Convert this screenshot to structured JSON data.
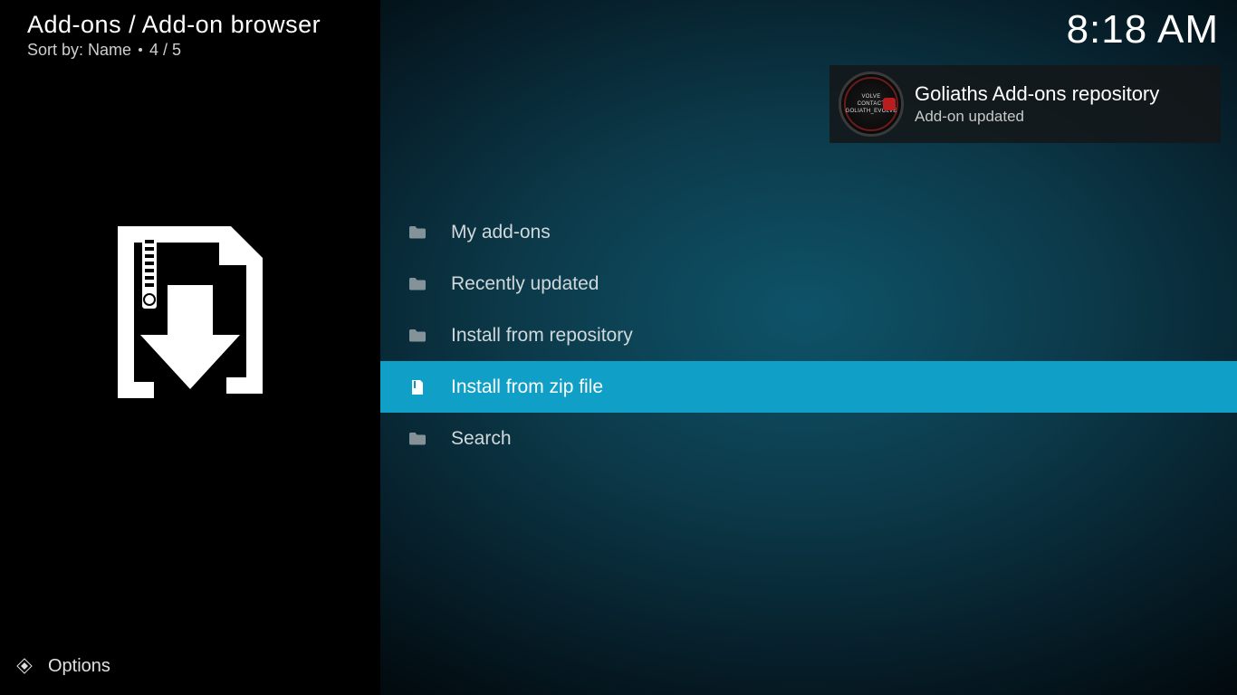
{
  "header": {
    "breadcrumb": "Add-ons / Add-on browser",
    "sort_prefix": "Sort by: ",
    "sort_value": "Name",
    "position": "4 / 5"
  },
  "clock": "8:18 AM",
  "notification": {
    "title": "Goliaths Add-ons repository",
    "subtitle": "Add-on updated",
    "icon_text_top": "VOLVE",
    "icon_text_mid": "CONTACT",
    "icon_text_bot": "GOLIATH_EVOLVE"
  },
  "menu": {
    "items": [
      {
        "label": "My add-ons",
        "icon": "folder",
        "selected": false
      },
      {
        "label": "Recently updated",
        "icon": "folder",
        "selected": false
      },
      {
        "label": "Install from repository",
        "icon": "folder",
        "selected": false
      },
      {
        "label": "Install from zip file",
        "icon": "zip",
        "selected": true
      },
      {
        "label": "Search",
        "icon": "folder",
        "selected": false
      }
    ]
  },
  "footer": {
    "options_label": "Options"
  }
}
